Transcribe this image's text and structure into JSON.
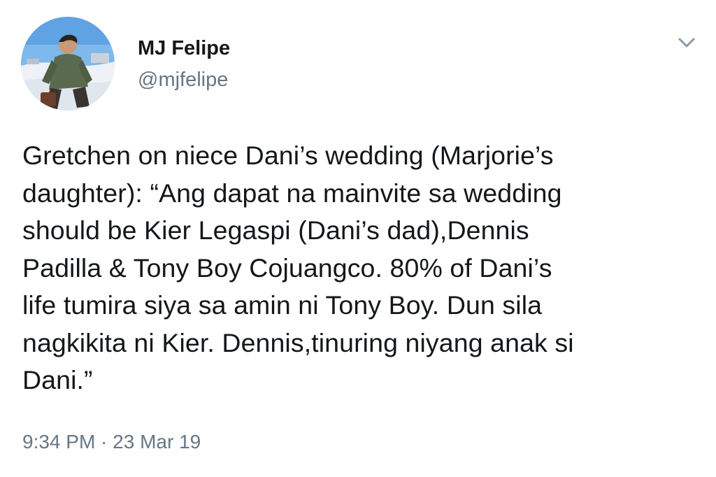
{
  "author": {
    "name": "MJ Felipe",
    "handle": "@mjfelipe",
    "avatar_icon": "profile-photo"
  },
  "menu_icon": "chevron-down-icon",
  "tweet": {
    "text": "Gretchen on niece Dani’s wedding (Marjorie’s\ndaughter): “Ang dapat na mainvite sa wedding\nshould be Kier Legaspi (Dani’s dad),Dennis\nPadilla & Tony Boy Cojuangco. 80% of Dani’s\nlife tumira siya sa amin ni Tony Boy. Dun sila\nnagkikita ni Kier. Dennis,tinuring niyang anak si\nDani.”",
    "timestamp": "9:34 PM · 23 Mar 19"
  },
  "colors": {
    "text": "#14171a",
    "secondary": "#657786",
    "background": "#ffffff"
  }
}
